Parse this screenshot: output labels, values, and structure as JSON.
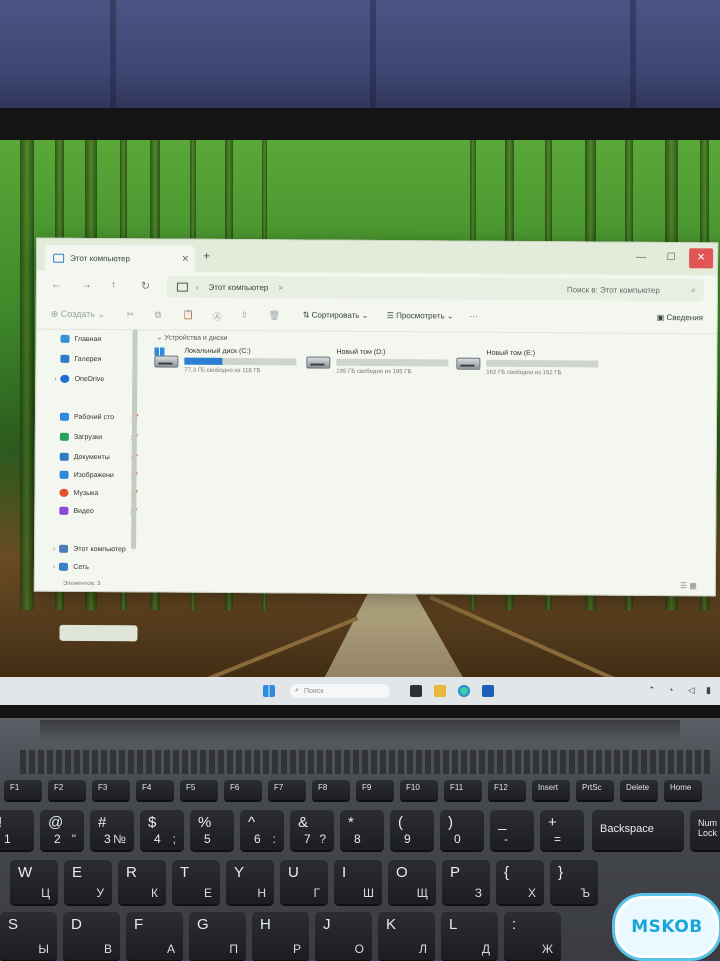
{
  "explorer": {
    "tab_title": "Этот компьютер",
    "address": "Этот компьютер",
    "address_sep": ">",
    "search_placeholder": "Поиск в: Этот компьютер",
    "toolbar": {
      "create": "Создать",
      "sort": "Сортировать",
      "view": "Просмотреть",
      "more": "···",
      "details": "Сведения"
    },
    "sidebar": [
      {
        "label": "Главная",
        "icon": "home-icon",
        "color": "#3a8fd8"
      },
      {
        "label": "Галерея",
        "icon": "gallery-icon",
        "color": "#2e7bc8"
      },
      {
        "label": "OneDrive",
        "icon": "onedrive-icon",
        "color": "#1f6fd1"
      },
      {
        "label": "Рабочий сто",
        "icon": "desktop-icon",
        "color": "#2b8be0"
      },
      {
        "label": "Загрузки",
        "icon": "downloads-icon",
        "color": "#2ba05c"
      },
      {
        "label": "Документы",
        "icon": "documents-icon",
        "color": "#3178c6"
      },
      {
        "label": "Изображени",
        "icon": "pictures-icon",
        "color": "#2d8ad8"
      },
      {
        "label": "Музыка",
        "icon": "music-icon",
        "color": "#e0552e"
      },
      {
        "label": "Видео",
        "icon": "video-icon",
        "color": "#8a4ad8"
      },
      {
        "label": "Этот компьютер",
        "icon": "this-pc-icon",
        "color": "#4a7fb8"
      },
      {
        "label": "Сеть",
        "icon": "network-icon",
        "color": "#3a7fc8"
      }
    ],
    "section_title": "Устройства и диски",
    "drives": [
      {
        "name": "Локальный диск (C:)",
        "free": "77,3 ГБ свободно из 118 ГБ",
        "used_fraction": 0.34
      },
      {
        "name": "Новый том (D:)",
        "free": "195 ГБ свободно из 195 ГБ",
        "used_fraction": 0.0
      },
      {
        "name": "Новый том (E:)",
        "free": "162 ГБ свободно из 162 ГБ",
        "used_fraction": 0.0
      }
    ],
    "status": "Элементов: 3"
  },
  "taskbar": {
    "search_placeholder": "Поиск"
  },
  "keyboard": {
    "row_numbers": [
      {
        "l": "!",
        "r": "1"
      },
      {
        "l": "@",
        "r": "2",
        "rr": "\""
      },
      {
        "l": "#",
        "r": "3",
        "rr": "№"
      },
      {
        "l": "$",
        "r": "4",
        "rr": ";"
      },
      {
        "l": "%",
        "r": "5"
      },
      {
        "l": "^",
        "r": "6",
        "rr": ":"
      },
      {
        "l": "&",
        "r": "7",
        "rr": "?"
      },
      {
        "l": "*",
        "r": "8"
      },
      {
        "l": "(",
        "r": "9"
      },
      {
        "l": ")",
        "r": "0"
      },
      {
        "l": "_",
        "r": "-"
      },
      {
        "l": "+",
        "r": "="
      }
    ],
    "backspace": "Backspace",
    "num_lock": "Num Lock",
    "row_qwerty": [
      {
        "l": "W",
        "rr": "Ц"
      },
      {
        "l": "E",
        "rr": "У"
      },
      {
        "l": "R",
        "rr": "К"
      },
      {
        "l": "T",
        "rr": "Е"
      },
      {
        "l": "Y",
        "rr": "Н"
      },
      {
        "l": "U",
        "rr": "Г"
      },
      {
        "l": "I",
        "rr": "Ш"
      },
      {
        "l": "O",
        "rr": "Щ"
      },
      {
        "l": "P",
        "rr": "З"
      },
      {
        "l": "{",
        "rr": "Х"
      },
      {
        "l": "}",
        "rr": "Ъ"
      }
    ],
    "row_home": [
      {
        "l": "S",
        "rr": "Ы"
      },
      {
        "l": "D",
        "rr": "В"
      },
      {
        "l": "F",
        "rr": "А"
      },
      {
        "l": "G",
        "rr": "П"
      },
      {
        "l": "H",
        "rr": "Р"
      },
      {
        "l": "J",
        "rr": "О"
      },
      {
        "l": "K",
        "rr": "Л"
      },
      {
        "l": "L",
        "rr": "Д"
      },
      {
        "l": ":",
        "rr": "Ж"
      }
    ],
    "fkeys": [
      "F1",
      "F2",
      "F3",
      "F4",
      "F5",
      "F6",
      "F7",
      "F8",
      "F9",
      "F10",
      "F11",
      "F12",
      "Insert",
      "PrtSc",
      "Delete",
      "Home"
    ]
  },
  "watermark": "MSKOB"
}
